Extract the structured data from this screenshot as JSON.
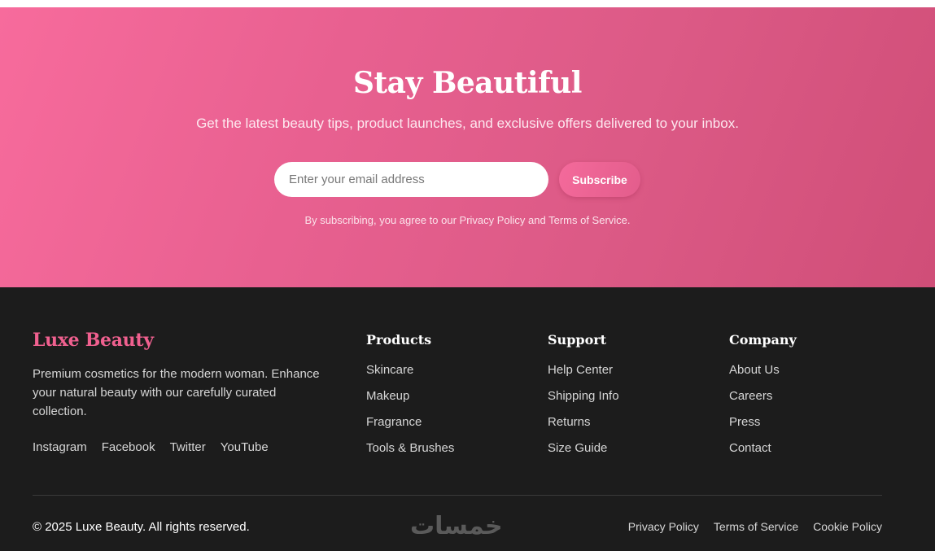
{
  "newsletter": {
    "title": "Stay Beautiful",
    "subtitle": "Get the latest beauty tips, product launches, and exclusive offers delivered to your inbox.",
    "email_placeholder": "Enter your email address",
    "subscribe_label": "Subscribe",
    "note": "By subscribing, you agree to our Privacy Policy and Terms of Service."
  },
  "footer": {
    "brand": "Luxe Beauty",
    "description": "Premium cosmetics for the modern woman. Enhance your natural beauty with our carefully curated collection.",
    "social": [
      "Instagram",
      "Facebook",
      "Twitter",
      "YouTube"
    ],
    "columns": [
      {
        "title": "Products",
        "links": [
          "Skincare",
          "Makeup",
          "Fragrance",
          "Tools & Brushes"
        ]
      },
      {
        "title": "Support",
        "links": [
          "Help Center",
          "Shipping Info",
          "Returns",
          "Size Guide"
        ]
      },
      {
        "title": "Company",
        "links": [
          "About Us",
          "Careers",
          "Press",
          "Contact"
        ]
      }
    ],
    "copyright": "© 2025 Luxe Beauty. All rights reserved.",
    "watermark": "خمسات",
    "legal": [
      "Privacy Policy",
      "Terms of Service",
      "Cookie Policy"
    ]
  },
  "colors": {
    "newsletter_gradient_start": "#f76b9c",
    "newsletter_gradient_end": "#d04e78",
    "footer_bg": "#1c1c1c",
    "brand_pink": "#f0608f"
  }
}
